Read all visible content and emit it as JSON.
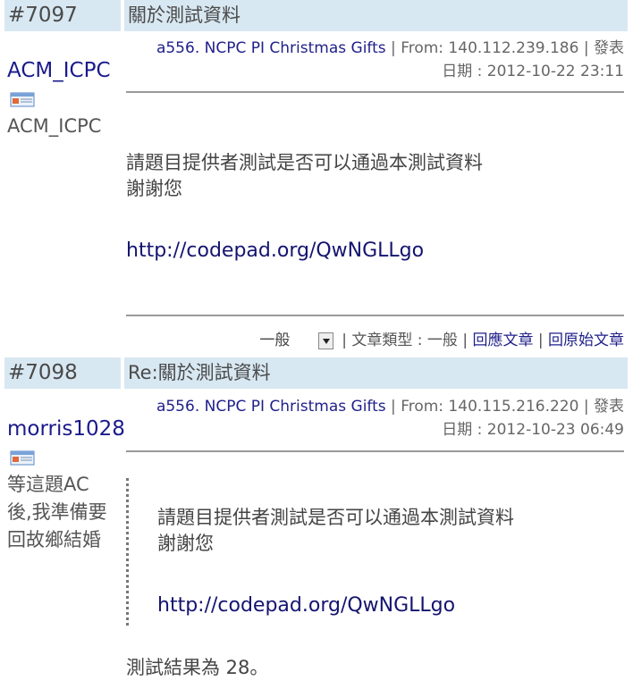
{
  "posts": [
    {
      "number": "#7097",
      "title": "關於測試資料",
      "author": "ACM_ICPC",
      "signature": "ACM_ICPC",
      "meta_problem": "a556. NCPC PI Christmas Gifts",
      "meta_from": "From: 140.112.239.186",
      "meta_posted_label": "發表",
      "meta_date": "日期 : 2012-10-22 23:11",
      "body_lines": [
        "請題目提供者測試是否可以通過本測試資料",
        "謝謝您"
      ],
      "link": "http://codepad.org/QwNGLLgo",
      "category_select": "一般",
      "article_type": "文章類型 : 一般",
      "reply_label": "回應文章",
      "original_label": "回原始文章"
    },
    {
      "number": "#7098",
      "title": "Re:關於測試資料",
      "author": "morris1028",
      "signature_lines": [
        "等這題AC",
        "後,我準備要",
        "回故鄉結婚"
      ],
      "meta_problem": "a556. NCPC PI Christmas Gifts",
      "meta_from": "From: 140.115.216.220",
      "meta_posted_label": "發表",
      "meta_date": "日期 : 2012-10-23 06:49",
      "quote_lines": [
        "請題目提供者測試是否可以通過本測試資料",
        "謝謝您"
      ],
      "quote_link": "http://codepad.org/QwNGLLgo",
      "reply_text": "測試結果為 28。"
    }
  ],
  "icons": {
    "user_message": "message-card-icon",
    "dropdown": "dropdown-arrow-icon"
  }
}
